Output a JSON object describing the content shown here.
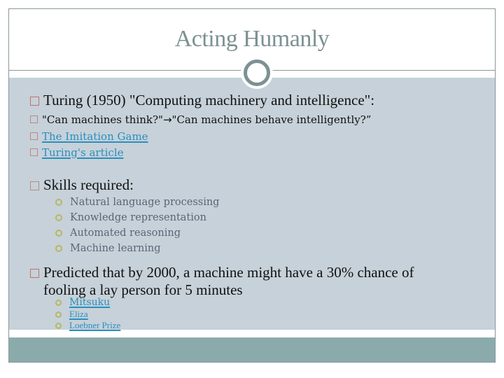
{
  "slide": {
    "title": "Acting Humanly",
    "colors": {
      "title": "#7c9192",
      "content_background": "#c6d1d9",
      "footer_band": "#8aaaab",
      "link": "#2a8fbe",
      "box_bullet": "#c0736a",
      "circle_bullet": "#b7b861",
      "sub_bullet_text": "#5a6577"
    }
  },
  "bullets": {
    "turing": {
      "text": "Turing (1950) \"Computing machinery and intelligence\":",
      "icon": "square-bullet-icon"
    },
    "question": {
      "text_before": "\"Can machines think?\" ",
      "arrow": "→",
      "text_after": " \"Can machines behave intelligently?”",
      "icon": "square-bullet-icon"
    },
    "links": [
      {
        "label": "The Imitation Game"
      },
      {
        "label": "Turing's article"
      }
    ],
    "skills": {
      "text": "Skills required:",
      "items": [
        {
          "label": "Natural language processing"
        },
        {
          "label": "Knowledge representation"
        },
        {
          "label": "Automated reasoning"
        },
        {
          "label": "Machine learning"
        }
      ]
    },
    "prediction": {
      "line1": "Predicted that by 2000, a machine might have a 30% chance of",
      "line2": "fooling a lay person for 5 minutes",
      "refs": [
        {
          "label": "Mitsuku"
        },
        {
          "label": "Eliza"
        },
        {
          "label": "Loebner Prize"
        }
      ]
    }
  }
}
